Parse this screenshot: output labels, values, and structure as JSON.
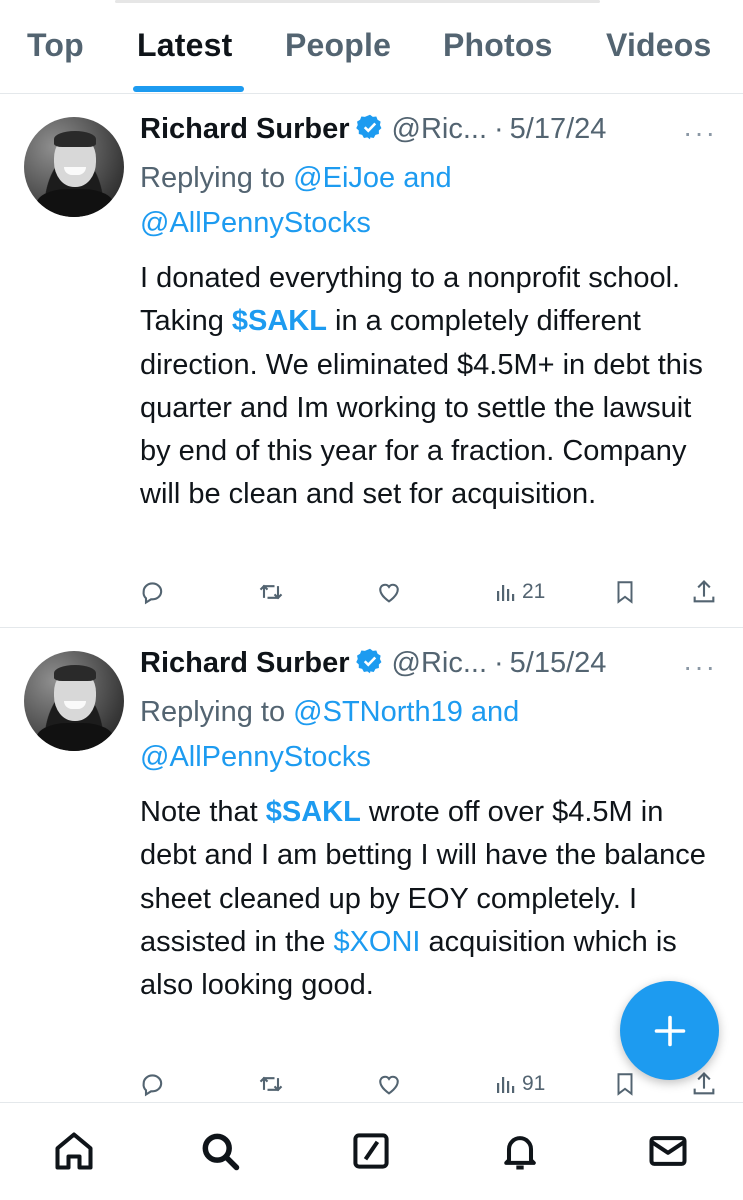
{
  "tabs": [
    {
      "label": "Top",
      "active": false
    },
    {
      "label": "Latest",
      "active": true
    },
    {
      "label": "People",
      "active": false
    },
    {
      "label": "Photos",
      "active": false
    },
    {
      "label": "Videos",
      "active": false
    }
  ],
  "tweets": [
    {
      "author": "Richard Surber",
      "handle": "@Ric...",
      "separator": "·",
      "date": "5/17/24",
      "more": "···",
      "reply_prefix": "Replying to",
      "reply_user1": "@EiJoe",
      "reply_and": "and",
      "reply_user2": "@AllPennyStocks",
      "text_1": "I donated everything to a nonprofit school.  Taking ",
      "cashtag": "$SAKL",
      "text_2": " in a completely different direction.  We eliminated $4.5M+ in debt this quarter and Im working to settle the lawsuit by end of this year for a fraction.  Company will be clean and set for acquisition.",
      "views": "21"
    },
    {
      "author": "Richard Surber",
      "handle": "@Ric...",
      "separator": "·",
      "date": "5/15/24",
      "more": "···",
      "reply_prefix": "Replying to",
      "reply_user1": "@STNorth19",
      "reply_and": "and",
      "reply_user2": "@AllPennyStocks",
      "text_0": "Note that ",
      "cashtag": "$SAKL",
      "text_1": " wrote off over $4.5M in debt and I am betting I will have the balance sheet cleaned up by EOY completely.  I assisted in the ",
      "cashtag2": "$XONI",
      "text_2": " acquisition which is also looking good.",
      "views": "91"
    }
  ],
  "colors": {
    "accent": "#1d9bf0",
    "text": "#0f1419",
    "secondary": "#536471"
  },
  "icons": [
    "verified-badge-icon",
    "reply-icon",
    "retweet-icon",
    "like-icon",
    "views-icon",
    "bookmark-icon",
    "share-icon",
    "compose-plus-icon",
    "home-icon",
    "search-icon",
    "grok-icon",
    "notifications-icon",
    "messages-icon"
  ]
}
